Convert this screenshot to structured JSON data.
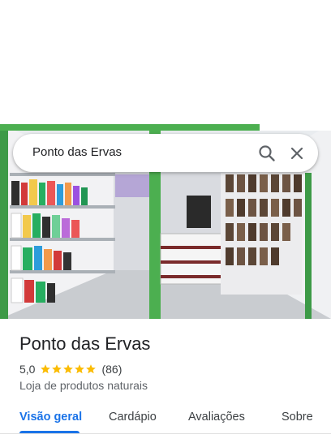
{
  "search": {
    "query": "Ponto das Ervas"
  },
  "place": {
    "name": "Ponto das Ervas",
    "rating": "5,0",
    "stars": 5,
    "review_count": "(86)",
    "category": "Loja de produtos naturais"
  },
  "tabs": [
    {
      "label": "Visão geral",
      "active": true
    },
    {
      "label": "Cardápio",
      "active": false
    },
    {
      "label": "Avaliações",
      "active": false
    },
    {
      "label": "Sobre",
      "active": false
    }
  ],
  "colors": {
    "accent": "#1a73e8",
    "star": "#fbbc04",
    "storefront_green": "#4caf50"
  },
  "icons": {
    "search": "search-icon",
    "close": "close-icon",
    "star": "star-icon"
  }
}
